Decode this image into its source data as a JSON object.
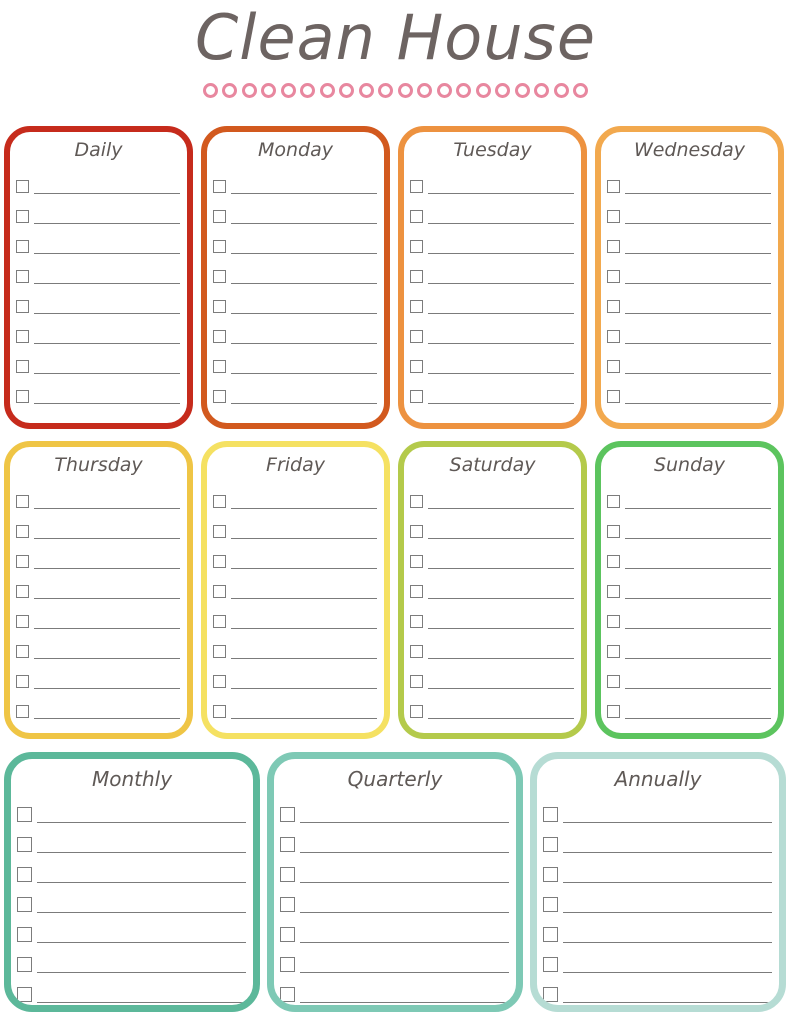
{
  "header": {
    "title": "Clean House",
    "ornament_count": 20,
    "ornament_color": "#e8879f",
    "title_color": "#6d6462",
    "ornament_icon": "circle-ring-ornament"
  },
  "page": {
    "background": "#ffffff",
    "line_color": "#7b7b7b",
    "checkbox_color": "#7c7c7c"
  },
  "card_rows": [
    {
      "row": 1,
      "cards": [
        {
          "title": "Daily",
          "accent": "#c62b1c",
          "lines": 8
        },
        {
          "title": "Monday",
          "accent": "#d2591e",
          "lines": 8
        },
        {
          "title": "Tuesday",
          "accent": "#ed9240",
          "lines": 8
        },
        {
          "title": "Wednesday",
          "accent": "#f2a94e",
          "lines": 8
        }
      ]
    },
    {
      "row": 2,
      "cards": [
        {
          "title": "Thursday",
          "accent": "#efc545",
          "lines": 8
        },
        {
          "title": "Friday",
          "accent": "#f5e162",
          "lines": 8
        },
        {
          "title": "Saturday",
          "accent": "#b4ca4b",
          "lines": 8
        },
        {
          "title": "Sunday",
          "accent": "#5cc45e",
          "lines": 8
        }
      ]
    },
    {
      "row": 3,
      "cards": [
        {
          "title": "Monthly",
          "accent": "#5cb89a",
          "lines": 7
        },
        {
          "title": "Quarterly",
          "accent": "#7ec9b5",
          "lines": 7
        },
        {
          "title": "Annually",
          "accent": "#b6dcd4",
          "lines": 7
        }
      ]
    }
  ]
}
